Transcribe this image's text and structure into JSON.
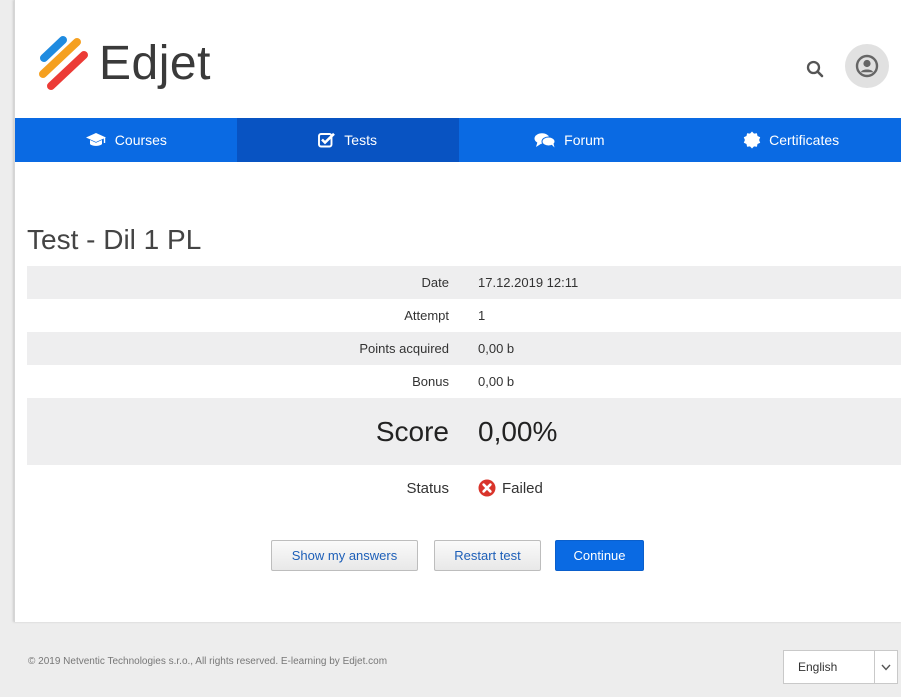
{
  "brand": {
    "name": "Edjet"
  },
  "nav": {
    "items": [
      {
        "label": "Courses",
        "icon": "graduation-cap-icon",
        "active": false
      },
      {
        "label": "Tests",
        "icon": "checkbox-icon",
        "active": true
      },
      {
        "label": "Forum",
        "icon": "chat-bubbles-icon",
        "active": false
      },
      {
        "label": "Certificates",
        "icon": "certificate-icon",
        "active": false
      }
    ]
  },
  "page": {
    "title": "Test - Dil 1 PL"
  },
  "results": {
    "date_label": "Date",
    "date_value": "17.12.2019 12:11",
    "attempt_label": "Attempt",
    "attempt_value": "1",
    "points_label": "Points acquired",
    "points_value": "0,00 b",
    "bonus_label": "Bonus",
    "bonus_value": "0,00 b",
    "score_label": "Score",
    "score_value": "0,00%",
    "status_label": "Status",
    "status_value": "Failed"
  },
  "actions": {
    "show_answers": "Show my answers",
    "restart": "Restart test",
    "continue": "Continue"
  },
  "footer": {
    "copyright": "© 2019 Netventic Technologies s.r.o., All rights reserved. E-learning by Edjet.com",
    "language": "English"
  },
  "colors": {
    "accent": "#0a6ae3",
    "nav_active": "#0853c2",
    "status_failed": "#d9342b"
  }
}
